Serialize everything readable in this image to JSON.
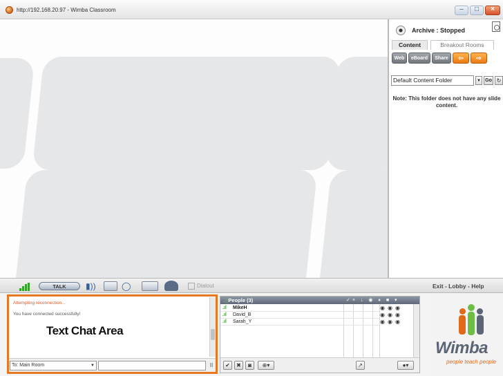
{
  "window": {
    "title": "http://192.168.20.97 - Wimba Classroom"
  },
  "right_panel": {
    "archive_status": "Archive : Stopped",
    "tabs": [
      {
        "label": "Content",
        "active": true
      },
      {
        "label": "Breakout Rooms",
        "active": false
      }
    ],
    "tool_buttons": [
      "Web",
      "eBoard",
      "Share"
    ],
    "folder_select": "Default Content Folder",
    "go_label": "Go",
    "note": "Note: This folder does not have any slide content."
  },
  "media_bar": {
    "talk_label": "TALK",
    "grayed_option": "Dialout",
    "nav_links": "Exit - Lobby - Help"
  },
  "chat": {
    "messages": [
      {
        "text": "Attempting reconnection...",
        "color": "#d9592a"
      },
      {
        "text": "You have connected successfully!",
        "color": "#555555"
      }
    ],
    "caption": "Text Chat Area",
    "room_prefix": "To:",
    "room": "Main Room",
    "pause_label": "II"
  },
  "people": {
    "title": "People (3)",
    "column_icons": "✓× ↓ ◉ ⏸ ■ ▾",
    "list": [
      {
        "name": "MikeH",
        "bold": true
      },
      {
        "name": "David_B",
        "bold": false
      },
      {
        "name": "Sarah_Y",
        "bold": false
      }
    ],
    "status_dots": "◉◉◉",
    "toolbar_buttons": [
      "✔",
      "✖",
      "◙",
      "⊕▾",
      "↗",
      "●▾"
    ]
  },
  "logo": {
    "word": "Wimba",
    "tagline": "people teach people",
    "colors": {
      "orange": "#e06a1a",
      "gray": "#5b6575",
      "green": "#6fbe44"
    }
  },
  "accent_color": "#e87722"
}
